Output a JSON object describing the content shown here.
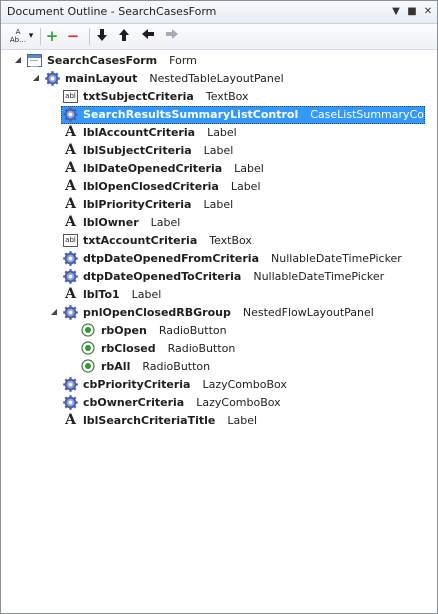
{
  "window": {
    "title": "Document Outline - SearchCasesForm",
    "controls": [
      "▼",
      "■",
      "✕"
    ]
  },
  "toolbar": {
    "sort_label_top": "A",
    "sort_label_bottom": "Ab…",
    "dropdown_glyph": "▾",
    "add_glyph": "+",
    "remove_glyph": "−",
    "move_down_glyph": "🡓",
    "move_up_glyph": "🡑",
    "move_left_glyph": "🡐",
    "move_right_glyph": "🡒"
  },
  "colors": {
    "selection": "#3399ff",
    "add": "#3aa63a",
    "remove": "#d23c3c",
    "gear": "#4a5ea8"
  },
  "tree": [
    {
      "name": "SearchCasesForm",
      "type": "Form",
      "icon": "form-icon",
      "level": 0,
      "expander": "expanded"
    },
    {
      "name": "mainLayout",
      "type": "NestedTableLayoutPanel",
      "icon": "gear-icon",
      "level": 1,
      "expander": "expanded"
    },
    {
      "name": "txtSubjectCriteria",
      "type": "TextBox",
      "icon": "textbox-icon",
      "level": 2
    },
    {
      "name": "SearchResultsSummaryListControl",
      "type": "CaseListSummaryControl",
      "icon": "gear-icon",
      "level": 2,
      "selected": true
    },
    {
      "name": "lblAccountCriteria",
      "type": "Label",
      "icon": "label-icon",
      "level": 2
    },
    {
      "name": "lblSubjectCriteria",
      "type": "Label",
      "icon": "label-icon",
      "level": 2
    },
    {
      "name": "lblDateOpenedCriteria",
      "type": "Label",
      "icon": "label-icon",
      "level": 2
    },
    {
      "name": "lblOpenClosedCriteria",
      "type": "Label",
      "icon": "label-icon",
      "level": 2
    },
    {
      "name": "lblPriorityCriteria",
      "type": "Label",
      "icon": "label-icon",
      "level": 2
    },
    {
      "name": "lblOwner",
      "type": "Label",
      "icon": "label-icon",
      "level": 2
    },
    {
      "name": "txtAccountCriteria",
      "type": "TextBox",
      "icon": "textbox-icon",
      "level": 2
    },
    {
      "name": "dtpDateOpenedFromCriteria",
      "type": "NullableDateTimePicker",
      "icon": "gear-icon",
      "level": 2
    },
    {
      "name": "dtpDateOpenedToCriteria",
      "type": "NullableDateTimePicker",
      "icon": "gear-icon",
      "level": 2
    },
    {
      "name": "lblTo1",
      "type": "Label",
      "icon": "label-icon",
      "level": 2
    },
    {
      "name": "pnlOpenClosedRBGroup",
      "type": "NestedFlowLayoutPanel",
      "icon": "gear-icon",
      "level": 2,
      "expander": "expanded"
    },
    {
      "name": "rbOpen",
      "type": "RadioButton",
      "icon": "radio-icon",
      "level": 3
    },
    {
      "name": "rbClosed",
      "type": "RadioButton",
      "icon": "radio-icon",
      "level": 3
    },
    {
      "name": "rbAll",
      "type": "RadioButton",
      "icon": "radio-icon",
      "level": 3
    },
    {
      "name": "cbPriorityCriteria",
      "type": "LazyComboBox",
      "icon": "gear-icon",
      "level": 2
    },
    {
      "name": "cbOwnerCriteria",
      "type": "LazyComboBox",
      "icon": "gear-icon",
      "level": 2
    },
    {
      "name": "lblSearchCriteriaTitle",
      "type": "Label",
      "icon": "label-icon",
      "level": 2
    }
  ]
}
